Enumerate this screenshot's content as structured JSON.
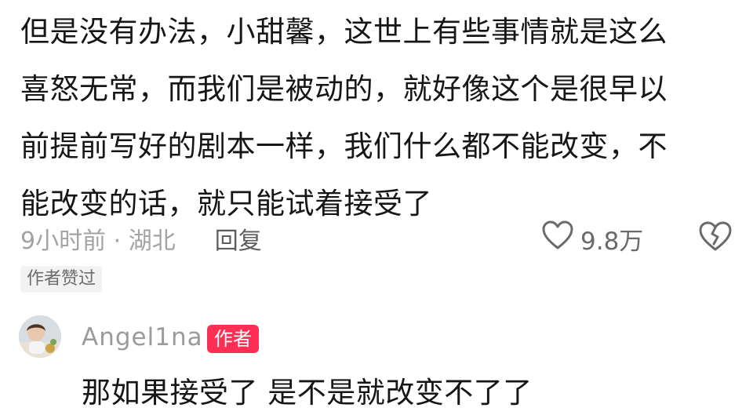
{
  "comment": {
    "lines": [
      "但是没有办法，小甜馨，这世上有些事情就是这么",
      "喜怒无常，而我们是被动的，就好像这个是很早以",
      "前提前写好的剧本一样，我们什么都不能改变，不",
      "能改变的话，就只能试着接受了"
    ],
    "time_location": "9小时前 · 湖北",
    "reply_label": "回复",
    "like_count": "9.8万",
    "liked_by_author": "作者赞过"
  },
  "reply": {
    "username": "Angel1na",
    "author_badge": "作者",
    "text": "那如果接受了 是不是就改变不了了"
  },
  "icons": {
    "like": "heart-outline-icon",
    "dislike": "broken-heart-icon"
  },
  "colors": {
    "author_badge_bg": "#ff2e54",
    "text_primary": "#161616",
    "text_secondary": "#a3a3a3"
  }
}
